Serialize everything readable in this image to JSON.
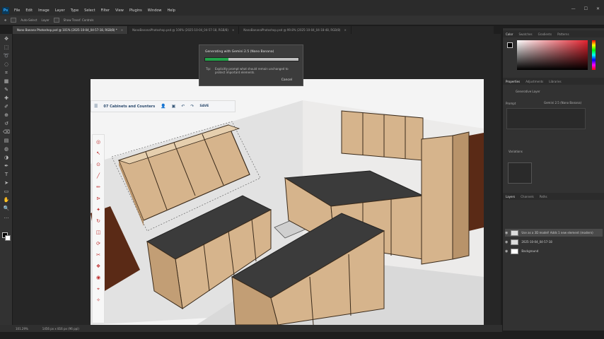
{
  "app": {
    "logo": "Ps",
    "menu": [
      "File",
      "Edit",
      "Image",
      "Layer",
      "Type",
      "Select",
      "Filter",
      "View",
      "Plugins",
      "Window",
      "Help"
    ],
    "window_controls": [
      "—",
      "☐",
      "✕"
    ]
  },
  "options_bar": {
    "auto_select_label": "Auto-Select",
    "layer_label": "Layer",
    "transform_label": "Show Transf. Controls"
  },
  "tabs": [
    {
      "label": "Nano Banana Photoshop.psd @ 101% (2025-10-04_04-57-18, RGB/8) *",
      "active": true
    },
    {
      "label": "NanoBananaPhotoshop.psd @ 100% (2025-10-04_04-57-18, RGB/8)",
      "active": false
    },
    {
      "label": "NanoBananaPhotoshop.psd @ 99.8% (2025-10-04_04-18-48, RGB/8)",
      "active": false
    }
  ],
  "tools": [
    "move-icon",
    "marquee-icon",
    "lasso-icon",
    "select-icon",
    "crop-icon",
    "frame-icon",
    "eyedropper-icon",
    "heal-icon",
    "brush-icon",
    "stamp-icon",
    "history-icon",
    "eraser-icon",
    "gradient-icon",
    "blur-icon",
    "dodge-icon",
    "pen-icon",
    "type-icon",
    "path-icon",
    "shape-icon",
    "hand-icon",
    "zoom-icon",
    "more-icon"
  ],
  "tool_glyphs": [
    "✥",
    "⬚",
    "➰",
    "◌",
    "⌗",
    "▦",
    "✎",
    "✚",
    "✐",
    "⊕",
    "↺",
    "⌫",
    "▤",
    "◍",
    "◑",
    "✒",
    "T",
    "➤",
    "▭",
    "✋",
    "🔍",
    "…"
  ],
  "sketchup": {
    "title": "07 Cabinets and Counters",
    "save_label": "SAVE",
    "tools": [
      "◎",
      "↖",
      "⊙",
      "╱",
      "✏",
      "⊳",
      "✦",
      "↻",
      "◫",
      "⟳",
      "✂",
      "❖",
      "◉",
      "⌖",
      "✧"
    ]
  },
  "dialog": {
    "title": "Generating with Gemini 2.5 (Nano Banana)",
    "progress": 0.25,
    "tip_label": "Tip:",
    "tip_text": "Explicitly prompt what should remain unchanged to protect important elements.",
    "cancel_label": "Cancel"
  },
  "panels": {
    "color_tabs": [
      "Color",
      "Swatches",
      "Gradients",
      "Patterns"
    ],
    "properties_tabs": [
      "Properties",
      "Adjustments",
      "Libraries"
    ],
    "generative_label": "Generative Layer",
    "model_label": "Gemini 2.5 (Nano Banana)",
    "prompt_label": "Prompt",
    "variations_label": "Variations",
    "layers_tabs": [
      "Layers",
      "Channels",
      "Paths"
    ],
    "layers": [
      {
        "name": "Use as a 3D model! Adds 1 new element (modern)",
        "selected": true
      },
      {
        "name": "2025-10-04_04-57-18",
        "selected": false
      },
      {
        "name": "Background",
        "selected": false
      }
    ]
  },
  "status": {
    "zoom": "101.29%",
    "size": "1456 px x 816 px (96 ppi)"
  },
  "colors": {
    "accent": "#22a34a",
    "brand": "#31a8ff"
  }
}
